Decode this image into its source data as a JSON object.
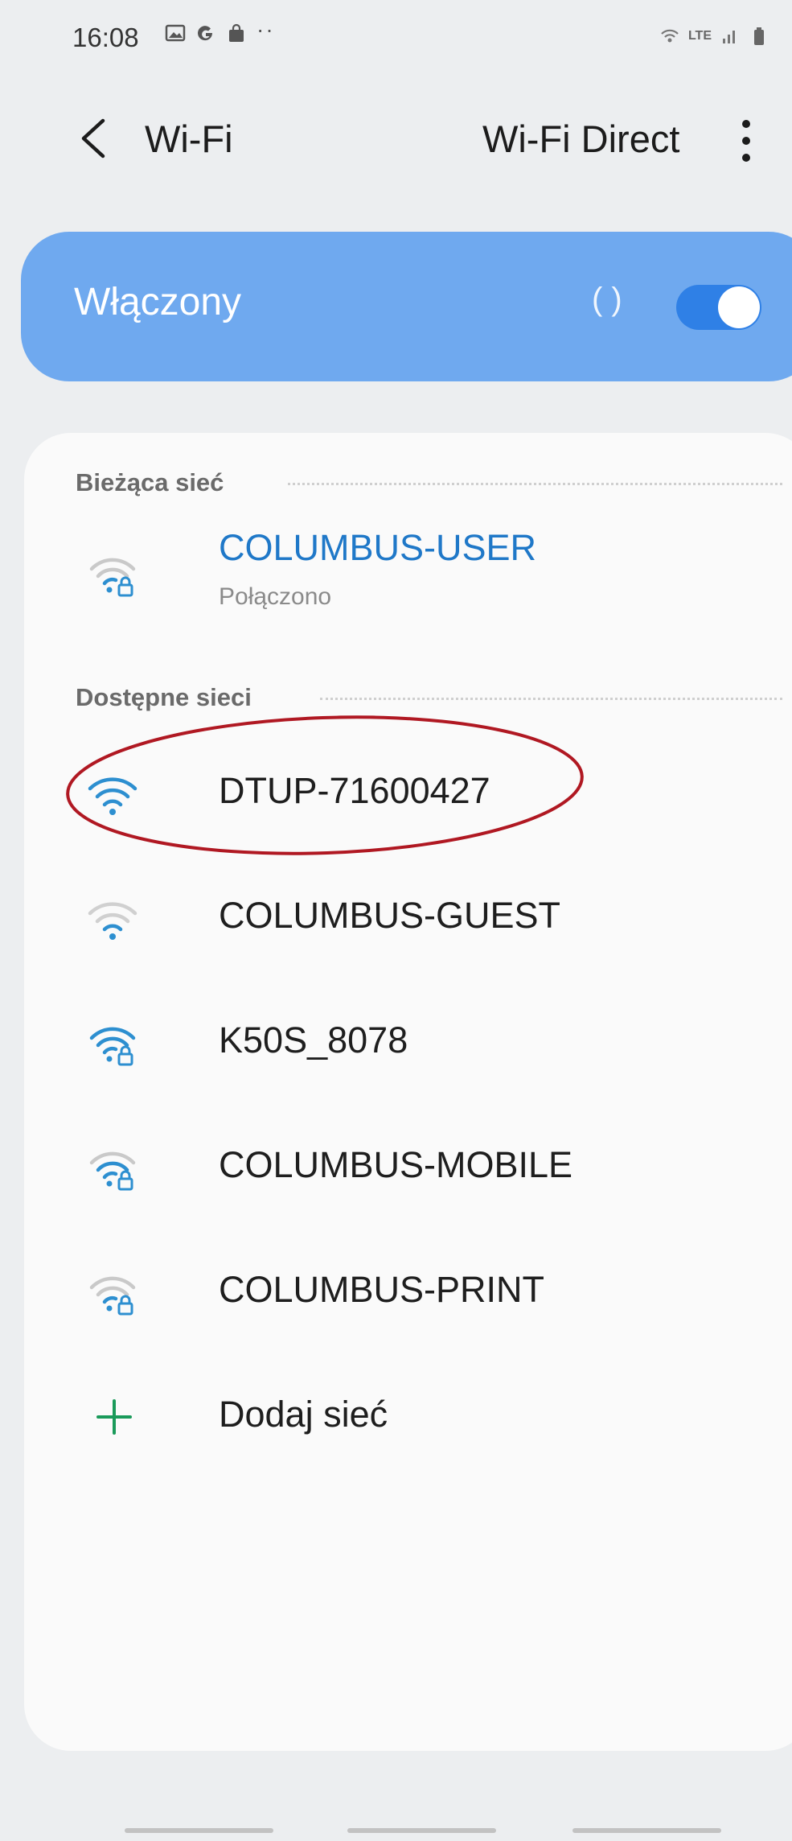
{
  "status_bar": {
    "time": "16:08",
    "left_icons": [
      "gallery-icon",
      "google-icon",
      "shopping-bag-icon"
    ],
    "more_dots": "··",
    "right_icons": [
      "wifi-calling-icon",
      "lte-icon",
      "signal-icon",
      "battery-icon"
    ],
    "lte_label": "LTE"
  },
  "app_bar": {
    "title": "Wi-Fi",
    "wifi_direct_label": "Wi-Fi Direct"
  },
  "master_switch": {
    "label": "Włączony",
    "progress_glyph": "( )",
    "enabled": true,
    "background_color": "#6fa9ef",
    "toggle_color": "#2f80e6"
  },
  "current_network_section": {
    "label": "Bieżąca sieć",
    "network": {
      "name": "COLUMBUS-USER",
      "status": "Połączono",
      "secured": true,
      "icon": "wifi-lock-icon"
    }
  },
  "available_networks_section": {
    "label": "Dostępne sieci",
    "networks": [
      {
        "name": "DTUP-71600427",
        "secured": false,
        "icon": "wifi-icon",
        "highlighted": true
      },
      {
        "name": "COLUMBUS-GUEST",
        "secured": false,
        "icon": "wifi-weak-icon"
      },
      {
        "name": "K50S_8078",
        "secured": true,
        "icon": "wifi-lock-icon"
      },
      {
        "name": "COLUMBUS-MOBILE",
        "secured": true,
        "icon": "wifi-lock-icon"
      },
      {
        "name": "COLUMBUS-PRINT",
        "secured": true,
        "icon": "wifi-lock-icon"
      }
    ],
    "add_network_label": "Dodaj sieć"
  },
  "colors": {
    "accent_blue": "#1f78c8",
    "add_green": "#1a9a5a",
    "highlight_red": "#b01822"
  }
}
